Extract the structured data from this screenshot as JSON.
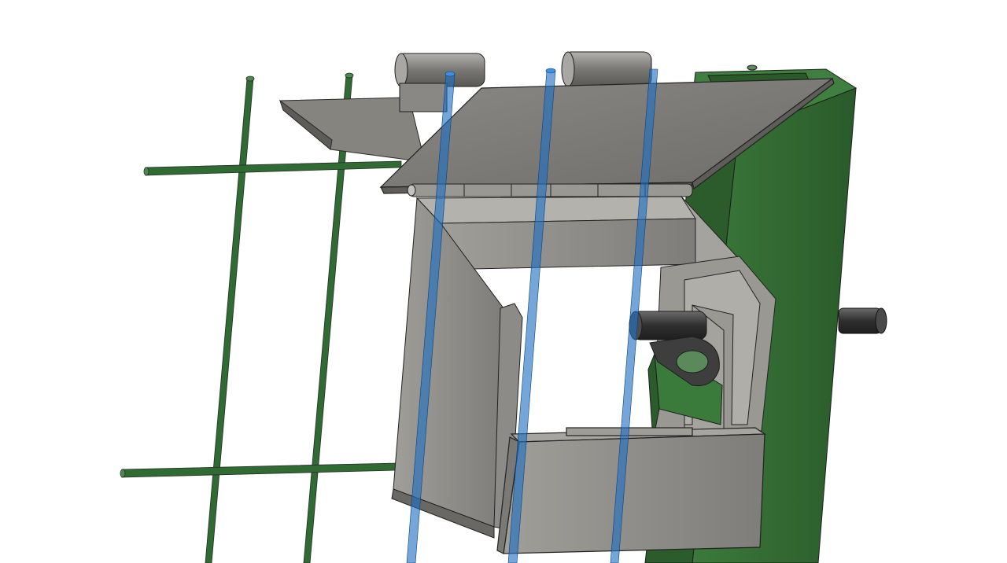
{
  "viewport": {
    "background": "#ffffff",
    "subject": "cad-assembly-model"
  },
  "colors": {
    "mesh_green": "#2f6b32",
    "post_green": "#336a33",
    "rod_blue": "#1f6fc4",
    "part_gray": "#8e8c87",
    "part_gray_light": "#9e9c97",
    "part_gray_dark": "#6e6c68",
    "edge": "#2a2a2a",
    "pin_dark": "#3d3d3d"
  },
  "icons": {
    "hinge": "hinge-knuckle-icon",
    "pin": "pin-icon",
    "lug": "lug-icon"
  }
}
